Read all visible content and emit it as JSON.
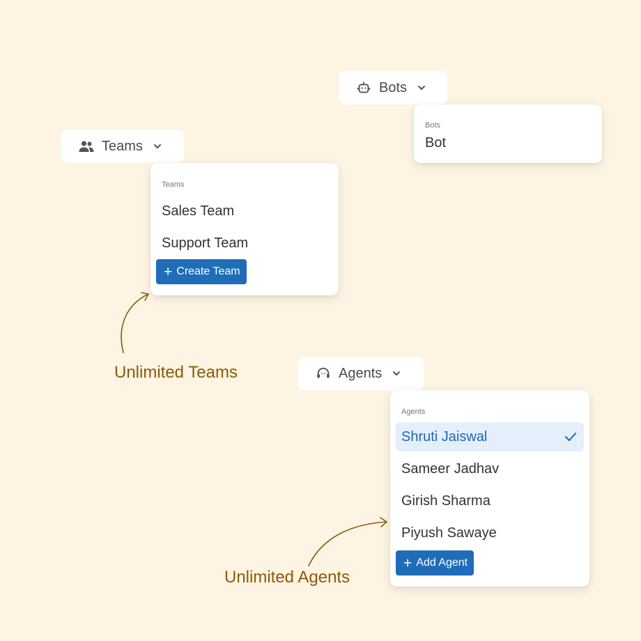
{
  "teams": {
    "trigger_label": "Teams",
    "trigger_icon": "people-icon",
    "menu_header": "Teams",
    "items": [
      "Sales Team",
      "Support Team"
    ],
    "create_label": "Create Team"
  },
  "bots": {
    "trigger_label": "Bots",
    "trigger_icon": "robot-icon",
    "menu_header": "Bots",
    "items": [
      "Bot"
    ]
  },
  "agents": {
    "trigger_label": "Agents",
    "trigger_icon": "headset-icon",
    "menu_header": "Agents",
    "items": [
      {
        "label": "Shruti Jaiswal",
        "selected": true
      },
      {
        "label": "Sameer Jadhav",
        "selected": false
      },
      {
        "label": "Girish Sharma",
        "selected": false
      },
      {
        "label": "Piyush Sawaye",
        "selected": false
      }
    ],
    "add_label": "Add Agent"
  },
  "captions": {
    "teams": "Unlimited Teams",
    "agents": "Unlimited Agents"
  },
  "colors": {
    "background": "#FDF4E3",
    "accent": "#1F6DB8",
    "selected_bg": "#E4EFFB",
    "selected_text": "#2067AE",
    "caption": "#8C5A06"
  }
}
